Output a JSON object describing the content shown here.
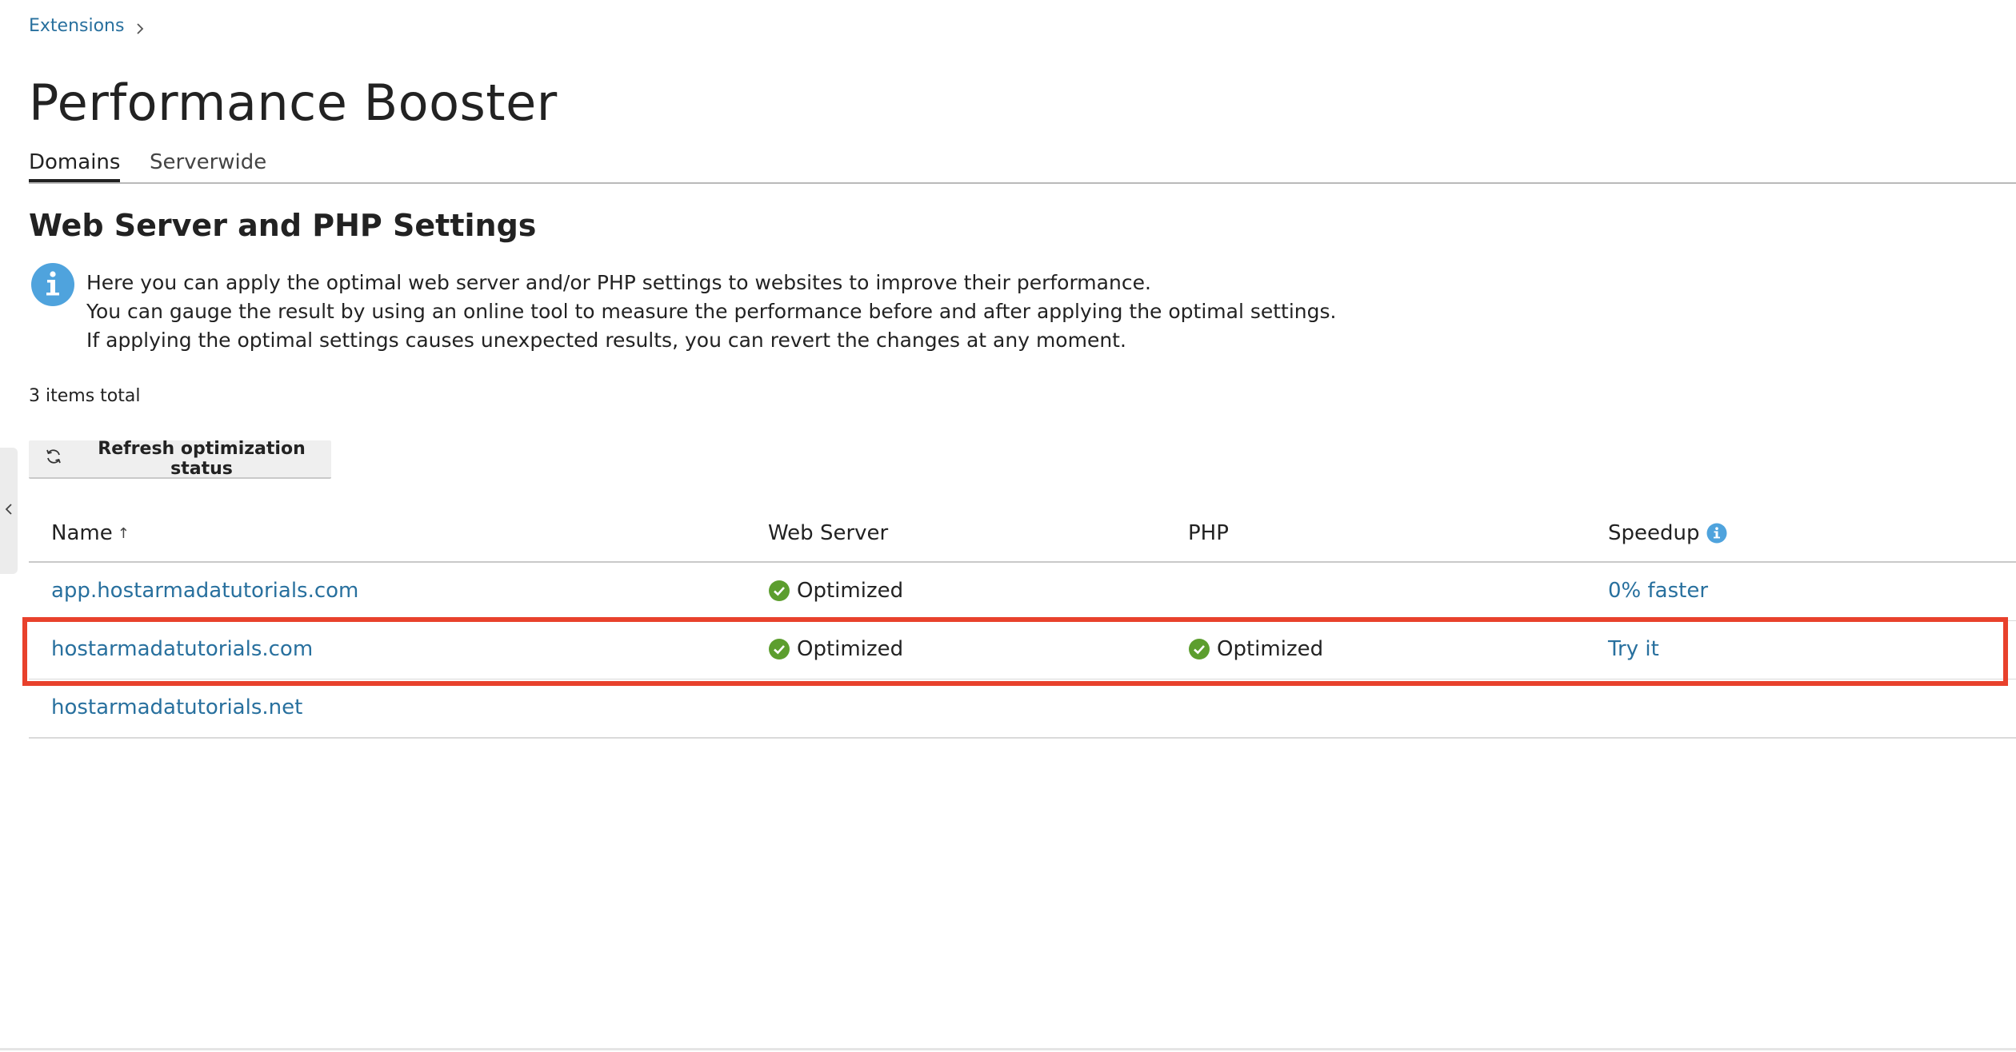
{
  "breadcrumb": {
    "label": "Extensions"
  },
  "page": {
    "title": "Performance Booster"
  },
  "tabs": [
    {
      "label": "Domains",
      "active": true
    },
    {
      "label": "Serverwide",
      "active": false
    }
  ],
  "section": {
    "title": "Web Server and PHP Settings",
    "info_lines": [
      "Here you can apply the optimal web server and/or PHP settings to websites to improve their performance.",
      "You can gauge the result by using an online tool to measure the performance before and after applying the optimal settings.",
      "If applying the optimal settings causes unexpected results, you can revert the changes at any moment."
    ]
  },
  "list": {
    "items_total": "3 items total",
    "refresh_label": "Refresh optimization status"
  },
  "table": {
    "columns": {
      "name": "Name",
      "name_sort": "↑",
      "web_server": "Web Server",
      "php": "PHP",
      "speedup": "Speedup"
    },
    "rows": [
      {
        "name": "app.hostarmadatutorials.com",
        "web_server": "Optimized",
        "php": "",
        "speedup": "0% faster"
      },
      {
        "name": "hostarmadatutorials.com",
        "web_server": "Optimized",
        "php": "Optimized",
        "speedup": "Try it"
      },
      {
        "name": "hostarmadatutorials.net",
        "web_server": "",
        "php": "",
        "speedup": ""
      }
    ]
  },
  "colors": {
    "link": "#28709e",
    "info_blue": "#4fa3dd",
    "success_green": "#5c9e2e",
    "highlight_red": "#e8412c"
  },
  "icons": {
    "breadcrumb_separator": "chevron-right-icon",
    "info": "info-icon",
    "refresh": "refresh-icon",
    "status": "check-circle-icon",
    "sort": "sort-arrow-up-icon",
    "collapse": "chevron-left-icon"
  }
}
